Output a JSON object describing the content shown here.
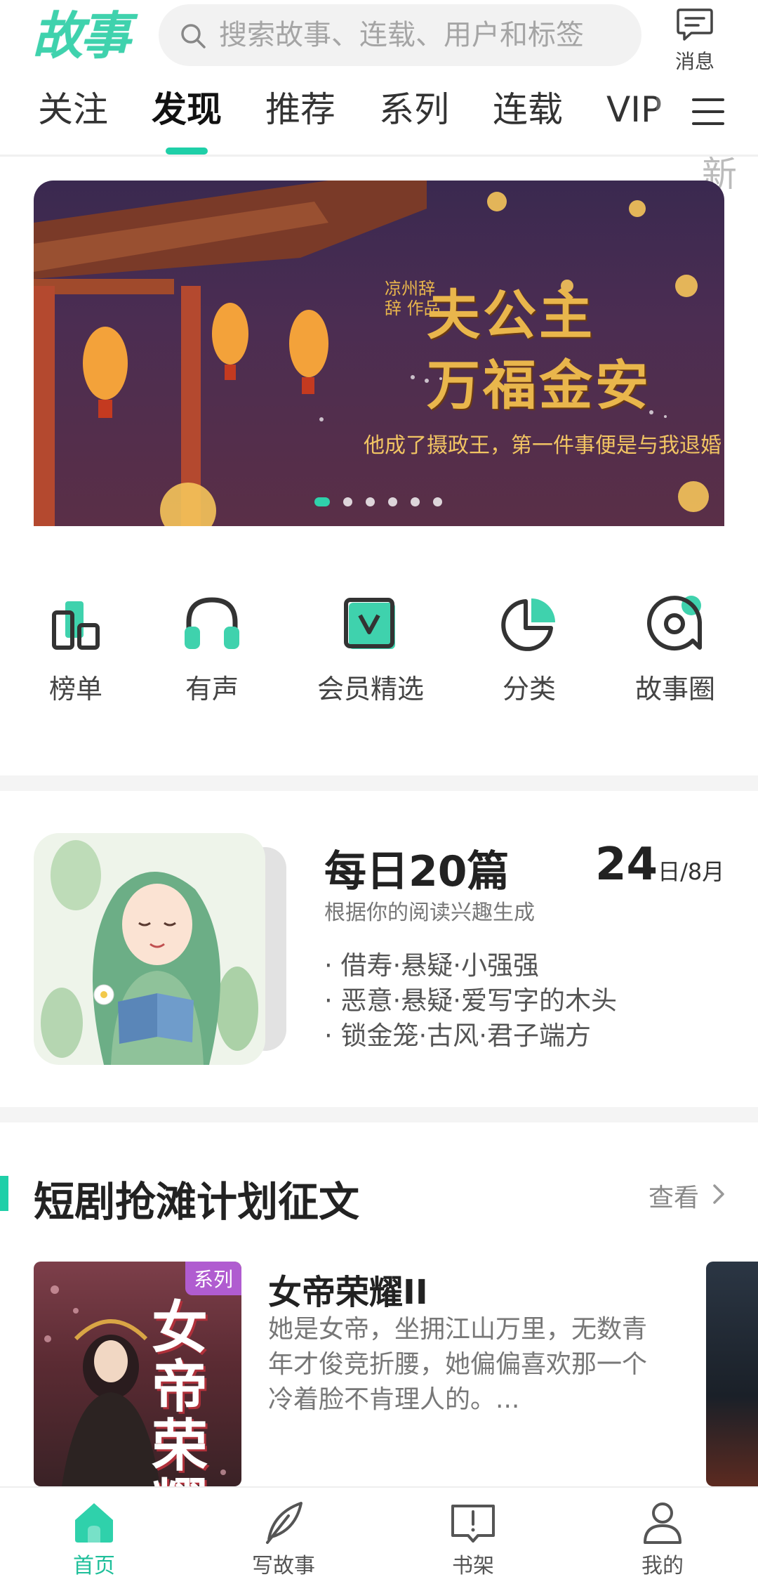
{
  "header": {
    "logo": "故事",
    "search_placeholder": "搜索故事、连载、用户和标签",
    "message_label": "消息"
  },
  "tabs": [
    "关注",
    "发现",
    "推荐",
    "系列",
    "连载",
    "VIP",
    "最新"
  ],
  "active_tab": "发现",
  "banner": {
    "author": "凉州辞辞 作品",
    "title_line1": "夫公主",
    "title_line2": "万福金安",
    "caption": "他成了摄政王，第一件事便是与我退婚",
    "slide_count": 6,
    "active_slide": 1
  },
  "quick_entries": [
    {
      "label": "榜单",
      "icon": "ranking-icon"
    },
    {
      "label": "有声",
      "icon": "headphones-icon"
    },
    {
      "label": "会员精选",
      "icon": "vip-selection-icon"
    },
    {
      "label": "分类",
      "icon": "category-pie-icon"
    },
    {
      "label": "故事圈",
      "icon": "at-circle-icon"
    }
  ],
  "daily": {
    "title": "每日20篇",
    "subtitle": "根据你的阅读兴趣生成",
    "day": "24",
    "month": "日/8月",
    "recommendations": [
      "· 借寿·悬疑·小强强",
      "· 恶意·悬疑·爱写字的木头",
      "· 锁金笼·古风·君子端方"
    ]
  },
  "section": {
    "title": "短剧抢滩计划征文",
    "more": "查看"
  },
  "book": {
    "badge": "系列",
    "cover_title": "女帝荣耀",
    "title": "女帝荣耀II",
    "description": "她是女帝，坐拥江山万里，无数青年才俊竞折腰，她偏偏喜欢那一个冷着脸不肯理人的。..."
  },
  "bottom_nav": [
    {
      "label": "首页",
      "icon": "home-icon"
    },
    {
      "label": "写故事",
      "icon": "feather-icon"
    },
    {
      "label": "书架",
      "icon": "bookshelf-icon"
    },
    {
      "label": "我的",
      "icon": "profile-icon"
    }
  ],
  "colors": {
    "accent": "#1fcfa8",
    "logo": "#3fd2ad",
    "badge": "#b05cd0"
  }
}
